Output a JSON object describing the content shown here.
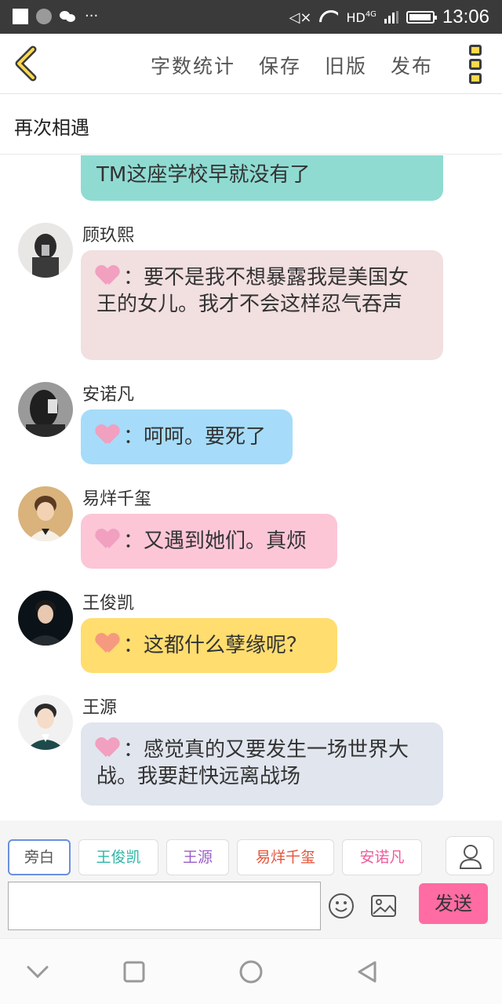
{
  "status_bar": {
    "network": "HD",
    "network_gen": "4G",
    "time": "13:06"
  },
  "header": {
    "actions": [
      "字数统计",
      "保存",
      "旧版",
      "发布"
    ]
  },
  "story": {
    "title": "再次相遇"
  },
  "messages": [
    {
      "speaker": "",
      "text": "TM这座学校早就没有了",
      "bubble_color": "#8fdbd2"
    },
    {
      "speaker": "顾玖熙",
      "prefix": "：",
      "text": "要不是我不想暴露我是美国女王的女儿。我才不会这样忍气吞声",
      "bubble_color": "#f2dfe0",
      "heart_color": "pink"
    },
    {
      "speaker": "安诺凡",
      "prefix": "：",
      "text": "呵呵。要死了",
      "bubble_color": "#a6dcf9",
      "heart_color": "pink"
    },
    {
      "speaker": "易烊千玺",
      "prefix": "：",
      "text": "又遇到她们。真烦",
      "bubble_color": "#fcc6d7",
      "heart_color": "pink"
    },
    {
      "speaker": "王俊凯",
      "prefix": "：",
      "text": "这都什么孽缘呢？",
      "bubble_color": "#ffdd6f",
      "heart_color": "orange"
    },
    {
      "speaker": "王源",
      "prefix": "：",
      "text": "感觉真的又要发生一场世界大战。我要赶快远离战场",
      "bubble_color": "#e0e5ee",
      "heart_color": "pink"
    }
  ],
  "role_chips": [
    {
      "label": "旁白",
      "color": "#555555"
    },
    {
      "label": "王俊凯",
      "color": "#2ab8a8"
    },
    {
      "label": "王源",
      "color": "#9b5ec8"
    },
    {
      "label": "易烊千玺",
      "color": "#e4553a"
    },
    {
      "label": "安诺凡",
      "color": "#ef5b9a"
    }
  ],
  "composer": {
    "input_value": "",
    "send_label": "发送"
  }
}
